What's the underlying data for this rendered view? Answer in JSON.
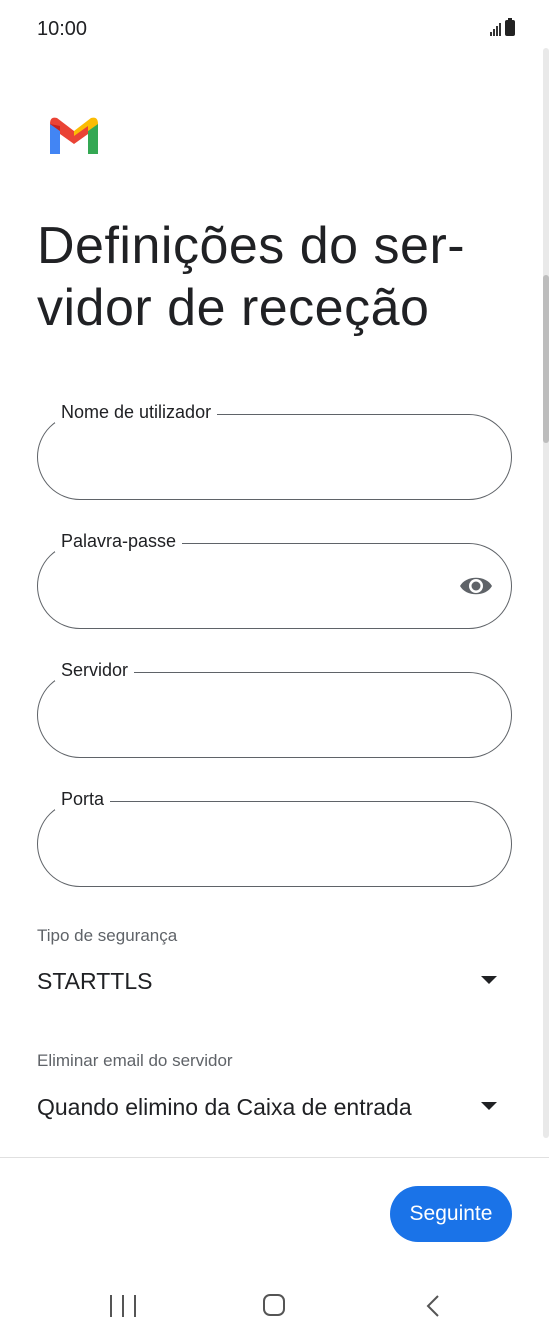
{
  "status_bar": {
    "time": "10:00",
    "icons": [
      "signal-icon",
      "battery-icon"
    ]
  },
  "logo": {
    "icon": "gmail-logo-icon",
    "colors": {
      "red": "#ea4335",
      "blue": "#4285f4",
      "green": "#34a853",
      "yellow": "#fbbc04",
      "dark_red": "#c5221f"
    }
  },
  "title": "Definições do ser-vidor de receção",
  "fields": {
    "username": {
      "label": "Nome de utilizador",
      "value": ""
    },
    "password": {
      "label": "Palavra-passe",
      "value": "",
      "toggle_icon": "eye-icon"
    },
    "server": {
      "label": "Servidor",
      "value": ""
    },
    "port": {
      "label": "Porta",
      "value": ""
    }
  },
  "security_type": {
    "label": "Tipo de segurança",
    "value": "STARTTLS"
  },
  "delete_email": {
    "label": "Eliminar email do servidor",
    "value": "Quando elimino da Caixa de entrada"
  },
  "next_button": {
    "label": "Seguinte",
    "color": "#1a73e8"
  },
  "nav_bar": {
    "icons": [
      "recents-icon",
      "home-icon",
      "back-icon"
    ]
  }
}
